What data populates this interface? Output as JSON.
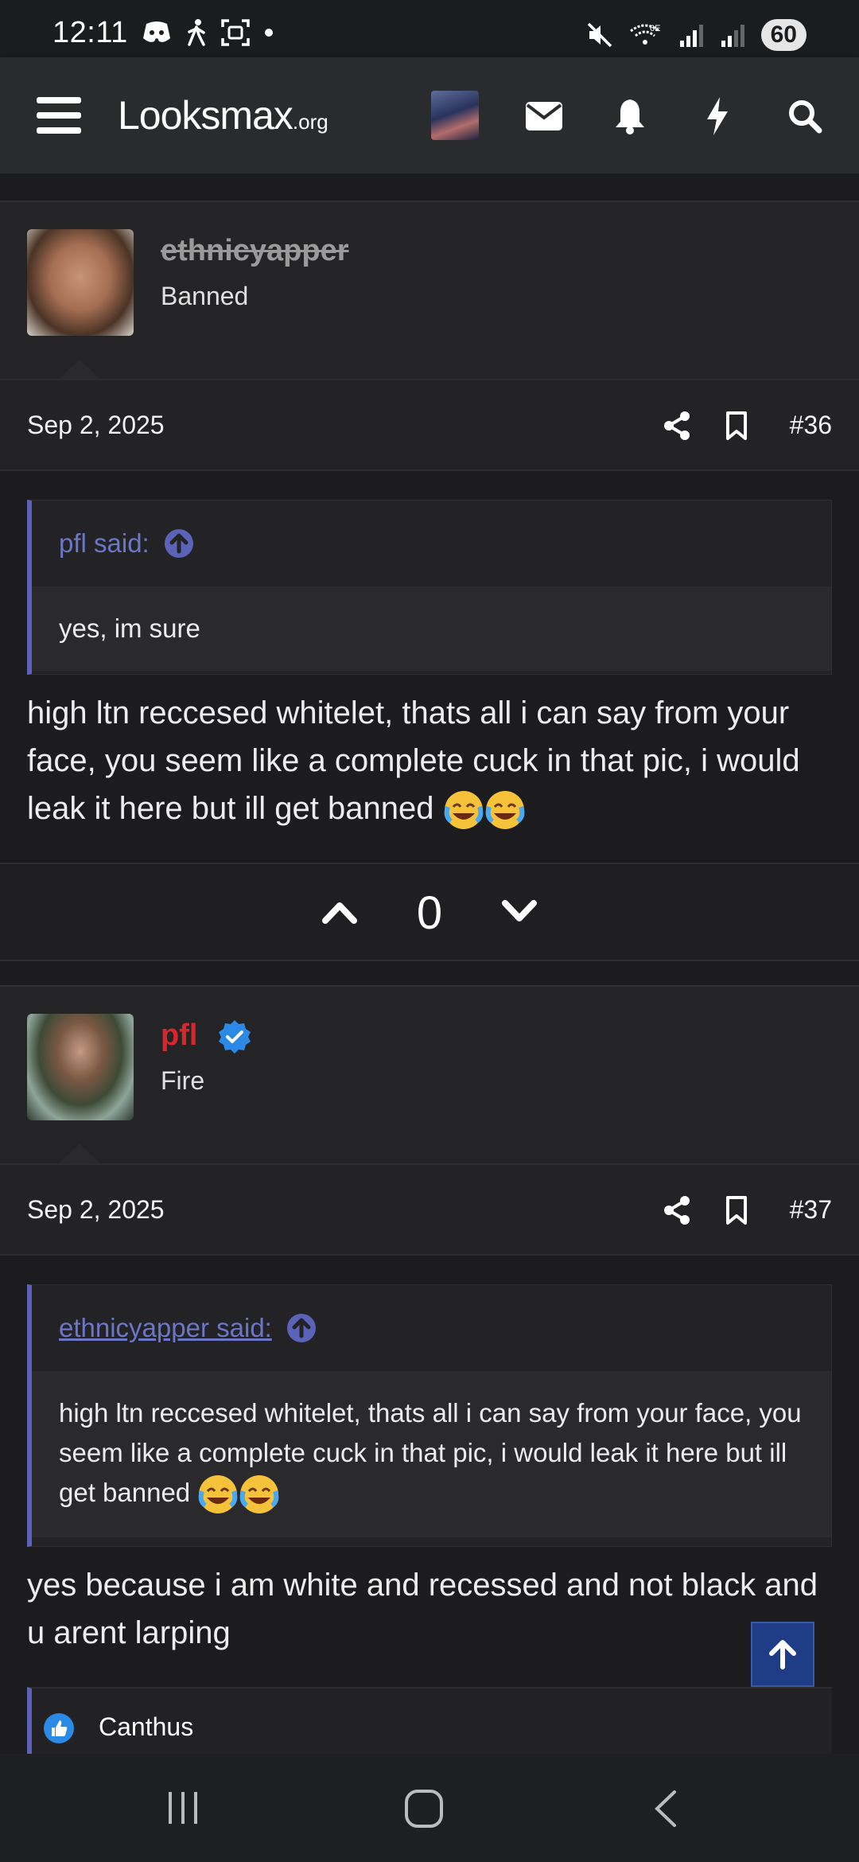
{
  "status_bar": {
    "time": "12:11",
    "battery": "60"
  },
  "header": {
    "logo": "Looksmax",
    "logo_suffix": ".org"
  },
  "posts": [
    {
      "username": "ethnicyapper",
      "user_title": "Banned",
      "date": "Sep 2, 2025",
      "number": "#36",
      "quote": {
        "author": "pfl said:",
        "text": "yes, im sure"
      },
      "body": "high ltn reccesed whitelet, thats all i can say from your face, you seem like a complete cuck in that pic, i would leak it here but ill get banned",
      "vote_count": "0"
    },
    {
      "username": "pfl",
      "user_title": "Fire",
      "date": "Sep 2, 2025",
      "number": "#37",
      "quote": {
        "author": "ethnicyapper said:",
        "text": "high ltn reccesed whitelet, thats all i can say from your face, you seem like a complete cuck in that pic, i would leak it here but ill get banned"
      },
      "body": "yes because i am white and recessed and not black and u arent larping",
      "reaction": "Canthus"
    }
  ],
  "colors": {
    "accent": "#5a63b8",
    "username_red": "#d9262a",
    "verified_blue": "#2a8ae6"
  }
}
